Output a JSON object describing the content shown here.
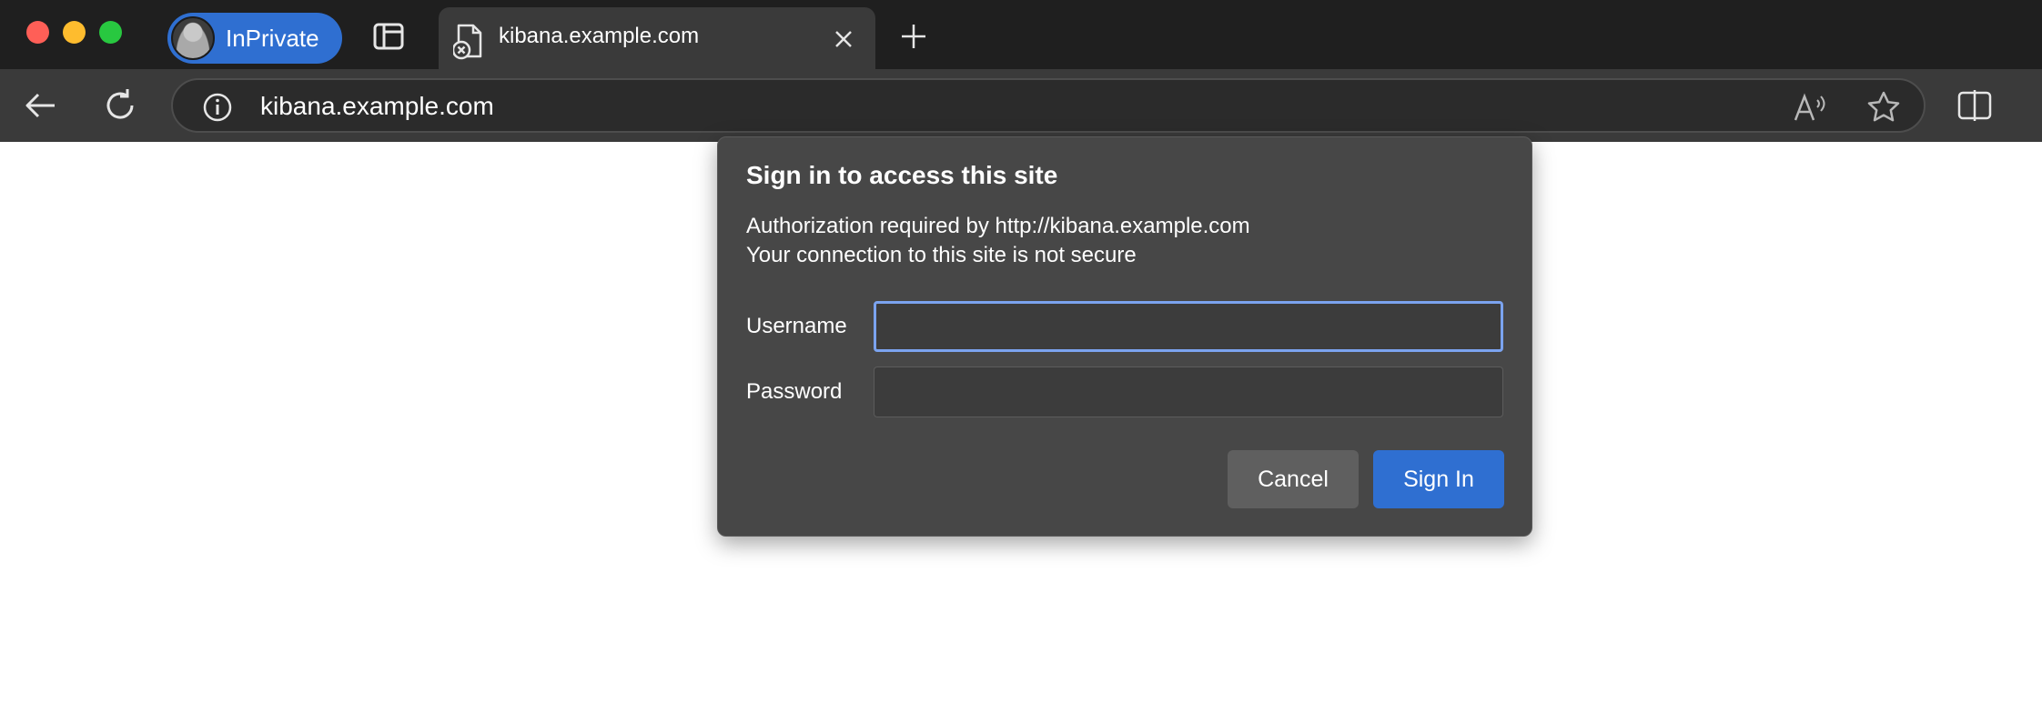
{
  "browser": {
    "inprivate_label": "InPrivate",
    "tab": {
      "title": "kibana.example.com",
      "favicon": "page-error-icon"
    },
    "address_bar": {
      "url": "kibana.example.com"
    },
    "icons": [
      "back-icon",
      "reload-icon",
      "info-icon",
      "read-aloud-icon",
      "favorite-icon",
      "split-screen-icon",
      "tab-actions-icon",
      "close-icon",
      "new-tab-icon"
    ]
  },
  "dialog": {
    "title": "Sign in to access this site",
    "line1": "Authorization required by http://kibana.example.com",
    "line2": "Your connection to this site is not secure",
    "username_label": "Username",
    "password_label": "Password",
    "username_value": "",
    "password_value": "",
    "cancel_label": "Cancel",
    "signin_label": "Sign In"
  },
  "colors": {
    "accent": "#2f6fd1",
    "titlebar": "#1f1f1f",
    "toolbar": "#3a3a3a",
    "dialog": "#474747",
    "focus": "#7ba3ef"
  }
}
